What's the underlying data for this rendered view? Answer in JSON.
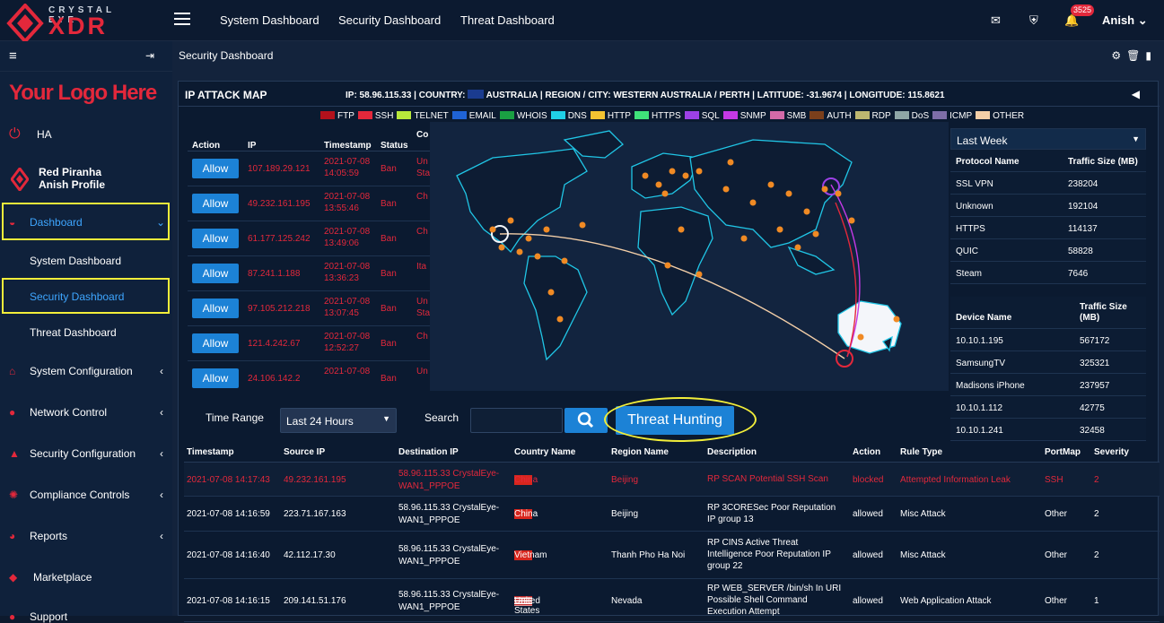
{
  "brand": {
    "top": "CRYSTAL EYE",
    "main": "XDR",
    "custom_logo": "Your Logo Here"
  },
  "top_nav": [
    "System Dashboard",
    "Security Dashboard",
    "Threat Dashboard"
  ],
  "notifications": {
    "count": "3525"
  },
  "user": {
    "name": "Anish"
  },
  "sidebar": {
    "ha": "HA",
    "profile_name": "Red Piranha",
    "profile_sub": "Anish Profile",
    "dashboard": "Dashboard",
    "sub": [
      "System Dashboard",
      "Security Dashboard",
      "Threat Dashboard"
    ],
    "items": [
      "System Configuration",
      "Network Control",
      "Security Configuration",
      "Compliance Controls",
      "Reports",
      "Marketplace",
      "Support"
    ]
  },
  "breadcrumb": "Security Dashboard",
  "map_header": {
    "title": "IP ATTACK MAP",
    "ip": "IP: 58.96.115.33",
    "country_label": "COUNTRY:",
    "country": "AUSTRALIA",
    "region": "REGION / CITY: WESTERN AUSTRALIA / PERTH",
    "lat": "LATITUDE: -31.9674",
    "lon": "LONGITUDE: 115.8621"
  },
  "legend": [
    {
      "label": "FTP",
      "color": "#b3111c"
    },
    {
      "label": "SSH",
      "color": "#e3283b"
    },
    {
      "label": "TELNET",
      "color": "#b7e83b"
    },
    {
      "label": "EMAIL",
      "color": "#1f63d6"
    },
    {
      "label": "WHOIS",
      "color": "#1aa043"
    },
    {
      "label": "DNS",
      "color": "#20d0e6"
    },
    {
      "label": "HTTP",
      "color": "#f3c332"
    },
    {
      "label": "HTTPS",
      "color": "#3fe27a"
    },
    {
      "label": "SQL",
      "color": "#9c41e6"
    },
    {
      "label": "SNMP",
      "color": "#c439e6"
    },
    {
      "label": "SMB",
      "color": "#d36aa8"
    },
    {
      "label": "AUTH",
      "color": "#7b3f1b"
    },
    {
      "label": "RDP",
      "color": "#bdb770"
    },
    {
      "label": "DoS",
      "color": "#8ea6a6"
    },
    {
      "label": "ICMP",
      "color": "#7e6ea8"
    },
    {
      "label": "OTHER",
      "color": "#f4cfa8"
    }
  ],
  "attack_table": {
    "headers": [
      "Action",
      "IP",
      "Timestamp",
      "Status",
      "Co"
    ],
    "allow_label": "Allow",
    "rows": [
      {
        "ip": "107.189.29.121",
        "date": "2021-07-08",
        "time": "14:05:59",
        "status": "Ban",
        "co": "Un",
        "co2": "Sta"
      },
      {
        "ip": "49.232.161.195",
        "date": "2021-07-08",
        "time": "13:55:46",
        "status": "Ban",
        "co": "Ch",
        "co2": ""
      },
      {
        "ip": "61.177.125.242",
        "date": "2021-07-08",
        "time": "13:49:06",
        "status": "Ban",
        "co": "Ch",
        "co2": ""
      },
      {
        "ip": "87.241.1.188",
        "date": "2021-07-08",
        "time": "13:36:23",
        "status": "Ban",
        "co": "Ita",
        "co2": ""
      },
      {
        "ip": "97.105.212.218",
        "date": "2021-07-08",
        "time": "13:07:45",
        "status": "Ban",
        "co": "Un",
        "co2": "Sta"
      },
      {
        "ip": "121.4.242.67",
        "date": "2021-07-08",
        "time": "12:52:27",
        "status": "Ban",
        "co": "Ch",
        "co2": ""
      },
      {
        "ip": "24.106.142.2",
        "date": "2021-07-08",
        "time": "",
        "status": "Ban",
        "co": "Un",
        "co2": ""
      }
    ]
  },
  "protocol_panel": {
    "range": "Last Week",
    "headers": [
      "Protocol Name",
      "Traffic Size (MB)"
    ],
    "rows": [
      [
        "SSL VPN",
        "238204"
      ],
      [
        "Unknown",
        "192104"
      ],
      [
        "HTTPS",
        "114137"
      ],
      [
        "QUIC",
        "58828"
      ],
      [
        "Steam",
        "7646"
      ]
    ]
  },
  "device_panel": {
    "headers": [
      "Device Name",
      "Traffic Size",
      "(MB)"
    ],
    "rows": [
      [
        "10.10.1.195",
        "567172"
      ],
      [
        "SamsungTV",
        "325321"
      ],
      [
        "Madisons iPhone",
        "237957"
      ],
      [
        "10.10.1.112",
        "42775"
      ],
      [
        "10.10.1.241",
        "32458"
      ]
    ]
  },
  "controls": {
    "time_range_label": "Time Range",
    "time_range_value": "Last 24 Hours",
    "search_label": "Search",
    "threat_hunting": "Threat Hunting"
  },
  "events": {
    "headers": [
      "Timestamp",
      "Source IP",
      "Destination IP",
      "Country Name",
      "Region Name",
      "Description",
      "Action",
      "Rule Type",
      "PortMap",
      "Severity"
    ],
    "rows": [
      {
        "ts": "2021-07-08 14:17:43",
        "src": "49.232.161.195",
        "dst1": "58.96.115.33 CrystalEye-",
        "dst2": "WAN1_PPPOE",
        "country": "China",
        "flag": "cn",
        "region": "Beijing",
        "desc": [
          "RP SCAN Potential SSH Scan"
        ],
        "action": "blocked",
        "rule": "Attempted Information Leak",
        "port": "SSH",
        "sev": "2",
        "alert": true
      },
      {
        "ts": "2021-07-08 14:16:59",
        "src": "223.71.167.163",
        "dst1": "58.96.115.33 CrystalEye-",
        "dst2": "WAN1_PPPOE",
        "country": "China",
        "flag": "cn",
        "region": "Beijing",
        "desc": [
          "RP 3CORESec Poor Reputation",
          "IP group 13"
        ],
        "action": "allowed",
        "rule": "Misc Attack",
        "port": "Other",
        "sev": "2",
        "alert": false
      },
      {
        "ts": "2021-07-08 14:16:40",
        "src": "42.112.17.30",
        "dst1": "58.96.115.33 CrystalEye-",
        "dst2": "WAN1_PPPOE",
        "country": "Vietnam",
        "flag": "vn",
        "region": "Thanh Pho Ha Noi",
        "desc": [
          "RP CINS Active Threat",
          "Intelligence Poor Reputation IP",
          "group 22"
        ],
        "action": "allowed",
        "rule": "Misc Attack",
        "port": "Other",
        "sev": "2",
        "alert": false
      },
      {
        "ts": "2021-07-08 14:16:15",
        "src": "209.141.51.176",
        "dst1": "58.96.115.33 CrystalEye-",
        "dst2": "WAN1_PPPOE",
        "country": "United States",
        "flag": "us",
        "region": "Nevada",
        "desc": [
          "RP WEB_SERVER /bin/sh In URI",
          "Possible Shell Command",
          "Execution Attempt"
        ],
        "action": "allowed",
        "rule": "Web Application Attack",
        "port": "Other",
        "sev": "1",
        "alert": false
      }
    ]
  }
}
